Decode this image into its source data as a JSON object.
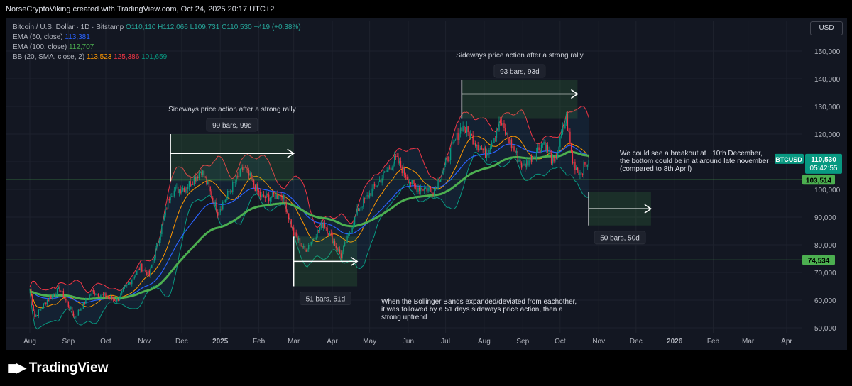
{
  "header": {
    "title": "NorseCryptoViking created with TradingView.com, Oct 24, 2025 20:17 UTC+2"
  },
  "legend": {
    "symbol": "Bitcoin / U.S. Dollar · 1D · Bitstamp",
    "ohlc": [
      "O110,110",
      "H112,066",
      "L109,731",
      "C110,530",
      "+419 (+0.38%)"
    ],
    "ema50": {
      "label": "EMA (50, close)",
      "value": "113,381",
      "color": "#2962ff"
    },
    "ema100": {
      "label": "EMA (100, close)",
      "value": "112,707",
      "color": "#4caf50"
    },
    "bb": {
      "label": "BB (20, SMA, close, 2)",
      "basis": "113,523",
      "upper": "125,386",
      "lower": "101,659"
    }
  },
  "currency_button": "USD",
  "branding": {
    "name": "TradingView"
  },
  "chart_data": {
    "type": "candlestick",
    "symbol": "BTCUSD",
    "x_tick_labels": [
      "Aug",
      "Sep",
      "Oct",
      "Nov",
      "Dec",
      "2025",
      "Feb",
      "Mar",
      "Apr",
      "May",
      "Jun",
      "Jul",
      "Aug",
      "Sep",
      "Oct",
      "Nov",
      "Dec",
      "2026",
      "Feb",
      "Mar",
      "Apr"
    ],
    "y_tick_labels": [
      "50,000",
      "60,000",
      "70,000",
      "80,000",
      "90,000",
      "100,000",
      "110,000",
      "120,000",
      "130,000",
      "140,000",
      "150,000"
    ],
    "ylim": [
      48000,
      158000
    ],
    "price_path": [
      [
        "2024-08-01",
        64000
      ],
      [
        "2024-08-05",
        54000
      ],
      [
        "2024-08-15",
        60000
      ],
      [
        "2024-08-25",
        64000
      ],
      [
        "2024-09-06",
        54000
      ],
      [
        "2024-09-20",
        63000
      ],
      [
        "2024-10-10",
        60000
      ],
      [
        "2024-10-29",
        72000
      ],
      [
        "2024-11-05",
        69000
      ],
      [
        "2024-11-22",
        99000
      ],
      [
        "2024-12-05",
        101000
      ],
      [
        "2024-12-17",
        107000
      ],
      [
        "2024-12-30",
        92000
      ],
      [
        "2025-01-20",
        108000
      ],
      [
        "2025-02-03",
        97000
      ],
      [
        "2025-02-20",
        98000
      ],
      [
        "2025-03-01",
        84000
      ],
      [
        "2025-03-10",
        78000
      ],
      [
        "2025-03-25",
        88000
      ],
      [
        "2025-04-08",
        76000
      ],
      [
        "2025-04-22",
        93000
      ],
      [
        "2025-05-22",
        111000
      ],
      [
        "2025-06-05",
        101000
      ],
      [
        "2025-06-22",
        100000
      ],
      [
        "2025-07-14",
        123000
      ],
      [
        "2025-08-02",
        113000
      ],
      [
        "2025-08-14",
        124000
      ],
      [
        "2025-09-01",
        108000
      ],
      [
        "2025-09-18",
        117000
      ],
      [
        "2025-09-26",
        109000
      ],
      [
        "2025-10-06",
        126000
      ],
      [
        "2025-10-11",
        110000
      ],
      [
        "2025-10-17",
        106000
      ],
      [
        "2025-10-24",
        110530
      ]
    ],
    "ema50": {
      "name": "EMA (50, close)",
      "last": 113381
    },
    "ema100": {
      "name": "EMA (100, close)",
      "last": 112707
    },
    "bollinger": {
      "name": "BB (20, SMA, close, 2)",
      "basis": 113523,
      "upper": 125386,
      "lower": 101659
    },
    "horizontal_lines": [
      {
        "price": 103514,
        "label": "103,514",
        "color": "#4caf50"
      },
      {
        "price": 74534,
        "label": "74,534",
        "color": "#4caf50"
      }
    ],
    "price_tag": {
      "symbol": "BTCUSD",
      "price": "110,530",
      "countdown": "05:42:55"
    },
    "ranges": [
      {
        "label": "99 bars, 99d",
        "from": "2024-11-22",
        "to": "2025-03-01",
        "low": 103000,
        "high": 120000,
        "arrow_price": 113000,
        "note": "Sideways price action after a strong rally"
      },
      {
        "label": "93 bars, 93d",
        "from": "2025-07-14",
        "to": "2025-10-15",
        "low": 125500,
        "high": 139500,
        "arrow_price": 134500,
        "note": "Sideways price action after a strong rally"
      },
      {
        "label": "51 bars, 51d",
        "from": "2025-03-01",
        "to": "2025-04-21",
        "low": 65000,
        "high": 83000,
        "arrow_price": 74000,
        "note": ""
      },
      {
        "label": "50 bars, 50d",
        "from": "2025-10-24",
        "to": "2025-12-13",
        "low": 87000,
        "high": 99000,
        "arrow_price": 93000,
        "note": ""
      }
    ],
    "annotations": [
      {
        "text": [
          "When the Bollinger Bands expanded/deviated from eachother,",
          "it was followed by a 51 days sideways price action, then a",
          "strong uptrend"
        ]
      },
      {
        "text": [
          "We could see a breakout at ~10th December,",
          "the bottom could be in at around late november",
          "(compared to 8th April)"
        ]
      }
    ]
  }
}
